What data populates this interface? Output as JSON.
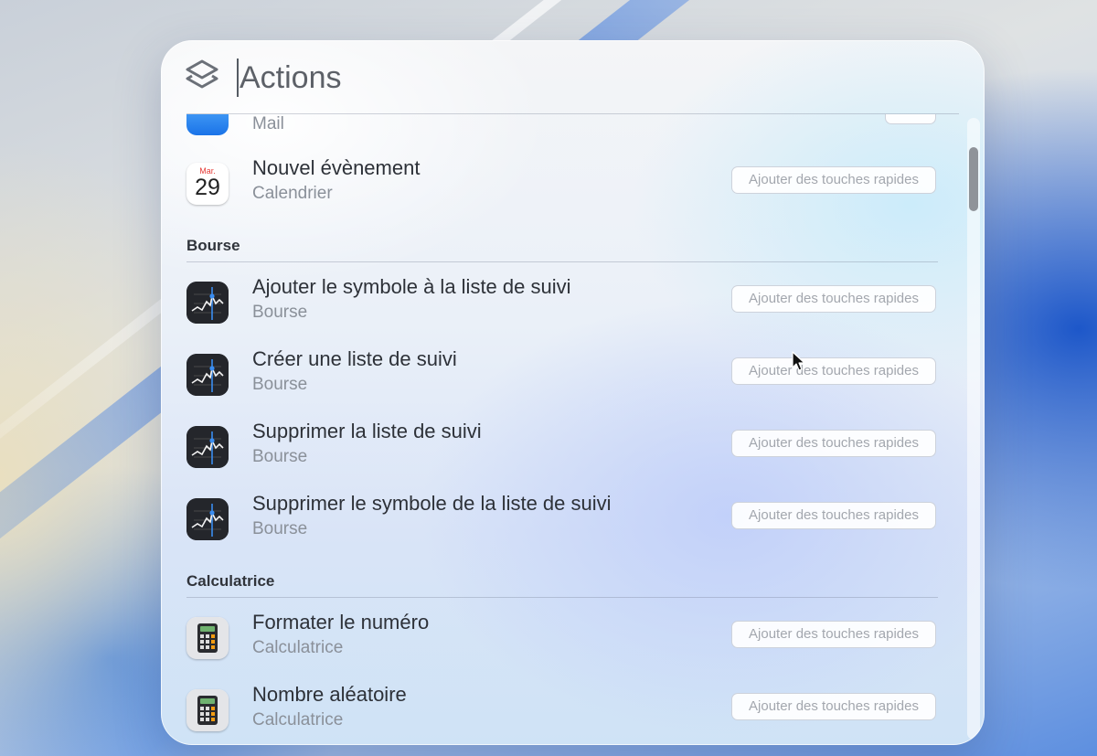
{
  "search": {
    "value": "Actions"
  },
  "shortcut_label": "Ajouter des touches rapides",
  "partial_row": {
    "subtitle": "Mail"
  },
  "rows_top": [
    {
      "name": "Nouvel évènement",
      "subtitle": "Calendrier",
      "cal_month": "Mar.",
      "cal_day": "29"
    }
  ],
  "sections": [
    {
      "title": "Bourse",
      "items": [
        {
          "name": "Ajouter le symbole à la liste de suivi",
          "subtitle": "Bourse"
        },
        {
          "name": "Créer une liste de suivi",
          "subtitle": "Bourse"
        },
        {
          "name": "Supprimer la liste de suivi",
          "subtitle": "Bourse"
        },
        {
          "name": "Supprimer le symbole de la liste de suivi",
          "subtitle": "Bourse"
        }
      ]
    },
    {
      "title": "Calculatrice",
      "items": [
        {
          "name": "Formater le numéro",
          "subtitle": "Calculatrice"
        },
        {
          "name": "Nombre aléatoire",
          "subtitle": "Calculatrice"
        }
      ]
    }
  ],
  "icons": {
    "app": "shortcuts-icon",
    "mail": "mail-icon",
    "calendar": "calendar-icon",
    "stocks": "stocks-icon",
    "calculator": "calculator-icon"
  }
}
